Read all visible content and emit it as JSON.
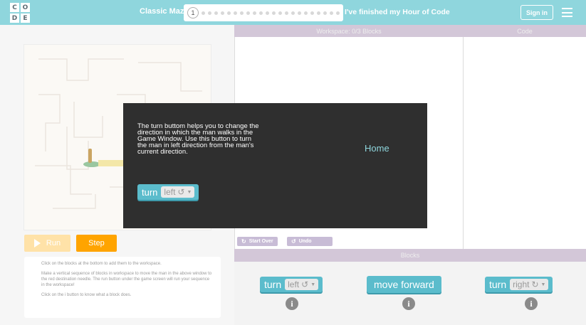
{
  "header": {
    "logo_letters": [
      "C",
      "O",
      "D",
      "E"
    ],
    "level_title": "Classic Maze",
    "current_level": "1",
    "finished_link": "I've finished my Hour of Code",
    "sign_in_label": "Sign in",
    "menu_icon": "hamburger-menu-icon",
    "bg_color": "#8fd6dd"
  },
  "game": {
    "run_label": "Run",
    "step_label": "Step",
    "instructions": [
      "Click on the blocks at the bottom to add them to the workspace.",
      "Make a vertical sequence of blocks in workspace to move the man in the above window to the red destination needle. The run button under the game screen will run your sequence in the workspace!",
      "Click on the i button to know what a block does."
    ]
  },
  "workspace": {
    "header": "Workspace: 0/3 Blocks",
    "start_over_label": "Start Over",
    "undo_label": "Undo",
    "code_header": "Code"
  },
  "blocks": {
    "header": "Blocks",
    "turn_left": {
      "verb": "turn",
      "option": "left",
      "glyph": "↺"
    },
    "move_forward": {
      "label": "move forward"
    },
    "turn_right": {
      "verb": "turn",
      "option": "right",
      "glyph": "↻"
    },
    "info_glyph": "i",
    "block_color": "#5bbccc"
  },
  "overlay": {
    "text": "The turn buttom helps you to change the direction in which the man walks in the Game Window. Use this button to turn the man in left direction from the man's current direction.",
    "home_label": "Home",
    "block": {
      "verb": "turn",
      "option": "left",
      "glyph": "↺"
    }
  }
}
